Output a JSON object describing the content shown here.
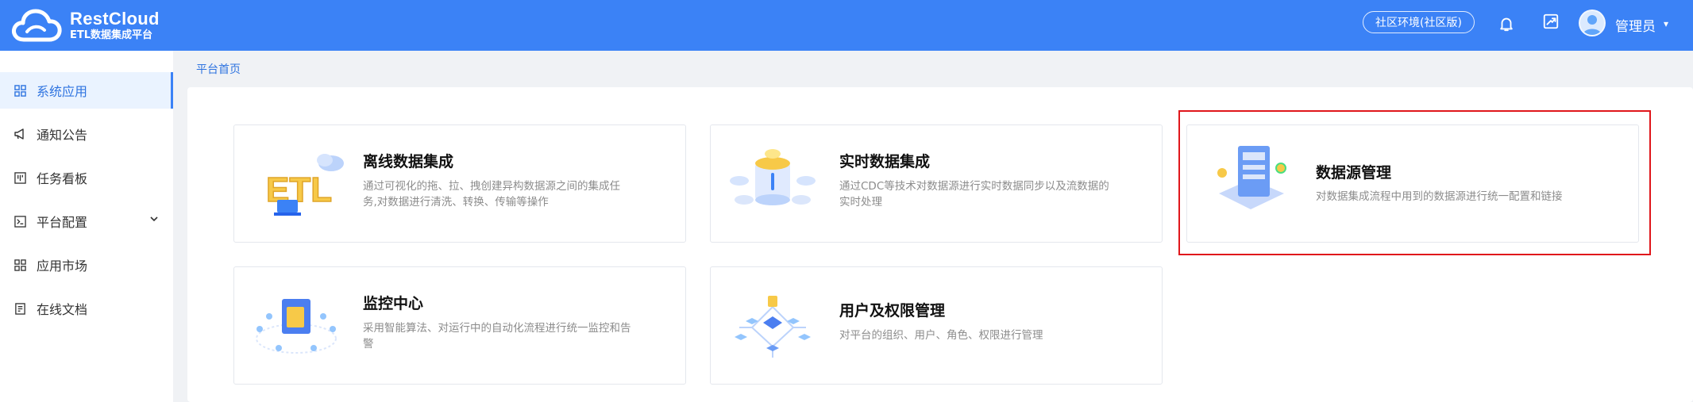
{
  "header": {
    "logo_title": "RestCloud",
    "logo_subtitle": "ETL数据集成平台",
    "env_badge": "社区环境(社区版)",
    "user_name": "管理员",
    "user_caret": "▾"
  },
  "sidebar": {
    "items": [
      {
        "label": "系统应用",
        "icon": "grid-icon"
      },
      {
        "label": "通知公告",
        "icon": "megaphone-icon"
      },
      {
        "label": "任务看板",
        "icon": "kanban-icon"
      },
      {
        "label": "平台配置",
        "icon": "terminal-icon",
        "expand": "⌄"
      },
      {
        "label": "应用市场",
        "icon": "grid-icon"
      },
      {
        "label": "在线文档",
        "icon": "document-icon"
      }
    ]
  },
  "breadcrumb": "平台首页",
  "cards": [
    {
      "title": "离线数据集成",
      "desc_line1": "通过可视化的拖、拉、拽创建异构数据源之间的集成任",
      "desc_line2": "务,对数据进行清洗、转换、传输等操作"
    },
    {
      "title": "实时数据集成",
      "desc_line1": "通过CDC等技术对数据源进行实时数据同步以及流数据的",
      "desc_line2": "实时处理"
    },
    {
      "title": "数据源管理",
      "desc_line1": "对数据集成流程中用到的数据源进行统一配置和链接"
    },
    {
      "title": "监控中心",
      "desc_line1": "采用智能算法、对运行中的自动化流程进行统一监控和告",
      "desc_line2": "警"
    },
    {
      "title": "用户及权限管理",
      "desc_line1": "对平台的组织、用户、角色、权限进行管理"
    }
  ],
  "illustration": {
    "etl_text": "ETL"
  },
  "colors": {
    "brand": "#3b82f6",
    "highlight": "#e0161b",
    "active_text": "#2f74e0"
  }
}
